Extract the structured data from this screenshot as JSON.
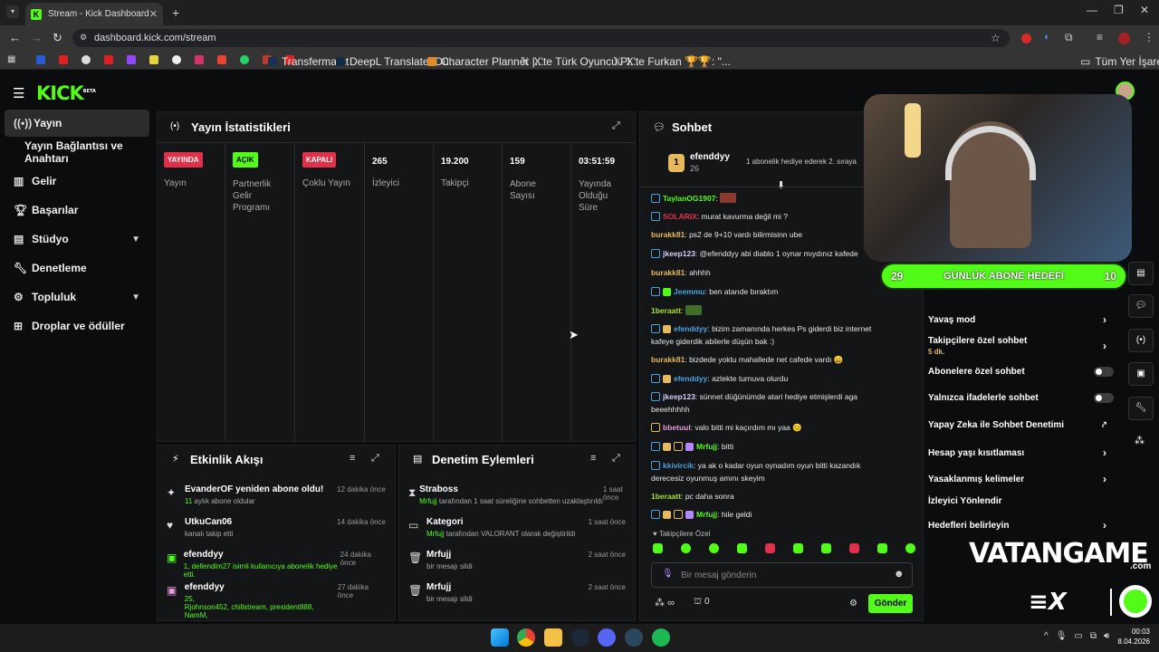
{
  "browser": {
    "tab_title": "Stream - Kick Dashboard",
    "url": "dashboard.kick.com/stream",
    "bookmarks": [
      "Transfermarkt",
      "DeepL Translate: Dü...",
      "Character Planner |...",
      "X'te Türk Oyuncu Pl...",
      "X'te Furkan 🏆🏆: \"...",
      "Tüm Yer İşaretleri"
    ]
  },
  "sidebar": {
    "logo": "KICK",
    "logo_sup": "BETA",
    "items": [
      {
        "label": "Yayın"
      },
      {
        "label": "Yayın Bağlantısı ve Anahtarı"
      },
      {
        "label": "Gelir"
      },
      {
        "label": "Başarılar"
      },
      {
        "label": "Stüdyo"
      },
      {
        "label": "Denetleme"
      },
      {
        "label": "Topluluk"
      },
      {
        "label": "Droplar ve ödüller"
      }
    ]
  },
  "stats": {
    "title": "Yayın İstatistikleri",
    "cols": [
      {
        "badge": "YAYINDA",
        "label": "Yayın"
      },
      {
        "badge": "AÇIK",
        "label": "Partnerlik Gelir Programı"
      },
      {
        "badge": "KAPALI",
        "label": "Çoklu Yayın"
      },
      {
        "value": "265",
        "label": "İzleyici"
      },
      {
        "value": "19.200",
        "label": "Takipçi"
      },
      {
        "value": "159",
        "label": "Abone Sayısı"
      },
      {
        "value": "03:51:59",
        "label": "Yayında Olduğu Süre"
      }
    ]
  },
  "activity": {
    "title": "Etkinlik Akışı",
    "items": [
      {
        "title": "EvanderOF yeniden abone oldu!",
        "sub_hl": "11",
        "sub": " aylık abone oldular",
        "time": "12 dakika önce"
      },
      {
        "title": "UtkuCan06",
        "sub": "kanalı takip etti",
        "time": "14 dakika önce"
      },
      {
        "title": "efenddyy",
        "sub_hl": "1, dellendim27",
        "sub": " isimli kullanıcıya abonelik hediye etti.",
        "time": "24 dakika önce"
      },
      {
        "title": "efenddyy",
        "sub_hl": "25,",
        "sub": "Rjohnson452, chillstream, president888, NamM,",
        "time": "27 dakika önce"
      }
    ]
  },
  "moderation": {
    "title": "Denetim Eylemleri",
    "items": [
      {
        "title": "Straboss",
        "sub_hl": "Mrfujj",
        "sub": " tarafından 1 saat süreliğine sohbetten uzaklaştırıldı",
        "time": "1 saat önce"
      },
      {
        "title": "Kategori",
        "sub_hl": "Mrfujj",
        "sub": " tarafından VALORANT olarak değiştirildi",
        "time": "1 saat önce"
      },
      {
        "title": "Mrfujj",
        "sub": "bir mesajı sildi",
        "time": "2 saat önce"
      },
      {
        "title": "Mrfujj",
        "sub": "bir mesajı sildi",
        "time": "2 saat önce"
      }
    ]
  },
  "chat": {
    "title": "Sohbet",
    "pinned_user": "efenddyy",
    "pinned_count": "26",
    "pinned_rank": "1",
    "pinned_text": "1 abonelik hediye ederek 2. sıraya",
    "messages": [
      {
        "user": "TaylanOG1907",
        "color": "#53fc18",
        "text": ""
      },
      {
        "user": "SOLARIX",
        "color": "#e0304a",
        "text": "murat kavurma değil mi ?"
      },
      {
        "user": "burakk81",
        "color": "#e5b95c",
        "text": "ps2 de 9+10 vardı bilirmisinn ube"
      },
      {
        "user": "jkeep123",
        "color": "#d0d0ff",
        "text": "@efenddyy abi diablo 1 oynar mıydınız kafede"
      },
      {
        "user": "burakk81",
        "color": "#e5b95c",
        "text": "ahhhh"
      },
      {
        "user": "Jeemmu",
        "color": "#4aa3df",
        "text": "ben atarıde bıraktım"
      },
      {
        "user": "1beraatt",
        "color": "#a6e22e",
        "text": ""
      },
      {
        "user": "efenddyy",
        "color": "#4aa3df",
        "text": "bizim zamanında herkes Ps giderdi biz internet kafeye giderdik abilerle düşün bak :)"
      },
      {
        "user": "burakk81",
        "color": "#e5b95c",
        "text": "bizdede yoktu mahallede net cafede vardı 😄"
      },
      {
        "user": "efenddyy",
        "color": "#4aa3df",
        "text": "aztekte turnuva olurdu"
      },
      {
        "user": "jkeep123",
        "color": "#d0d0ff",
        "text": "sünnet düğünümde atari hediye etmişlerdi aga beeehhhhh"
      },
      {
        "user": "bbetuul",
        "color": "#e89adf",
        "text": "valo bitti mi kaçırdım mı yaa 😊"
      },
      {
        "user": "Mrfujj",
        "color": "#53fc18",
        "text": "bitti"
      },
      {
        "user": "kkivircik",
        "color": "#4aa3df",
        "text": "ya ak o kadar oyun oynadım oyun bitti kazandık derecesiz oyunmuş amını skeyim"
      },
      {
        "user": "1beraatt",
        "color": "#a6e22e",
        "text": "pc daha sonra"
      },
      {
        "user": "Mrfujj",
        "color": "#53fc18",
        "text": "hile geldi"
      }
    ],
    "followers_only_label": "Takipçilere Özel",
    "input_placeholder": "Bir mesaj gönderin",
    "points": "∞",
    "gift_count": "0",
    "send_label": "Gönder"
  },
  "goal": {
    "left": "29",
    "text": "GÜNLÜK ABONE HEDEFİ",
    "right": "10"
  },
  "settings": [
    {
      "label": "Yavaş mod",
      "kind": "chevron"
    },
    {
      "label": "Takipçilere özel sohbet",
      "sub": "5 dk.",
      "kind": "chevron"
    },
    {
      "label": "Abonelere özel sohbet",
      "kind": "toggle"
    },
    {
      "label": "Yalnızca ifadelerle sohbet",
      "kind": "toggle"
    },
    {
      "label": "Yapay Zeka ile Sohbet Denetimi",
      "kind": "external"
    },
    {
      "label": "Hesap yaşı kısıtlaması",
      "kind": "chevron"
    },
    {
      "label": "Yasaklanmış kelimeler",
      "kind": "chevron"
    },
    {
      "label": "İzleyici Yönlendir",
      "kind": "none"
    },
    {
      "label": "Hedefleri belirleyin",
      "kind": "chevron"
    }
  ],
  "watermark": "VATANGAME",
  "watermark_sub": ".com",
  "clock": {
    "time": "00:03",
    "date": "8.04.2026"
  },
  "colors": {
    "accent": "#53fc18",
    "live": "#e0304a",
    "bg": "#0b0c0d"
  }
}
